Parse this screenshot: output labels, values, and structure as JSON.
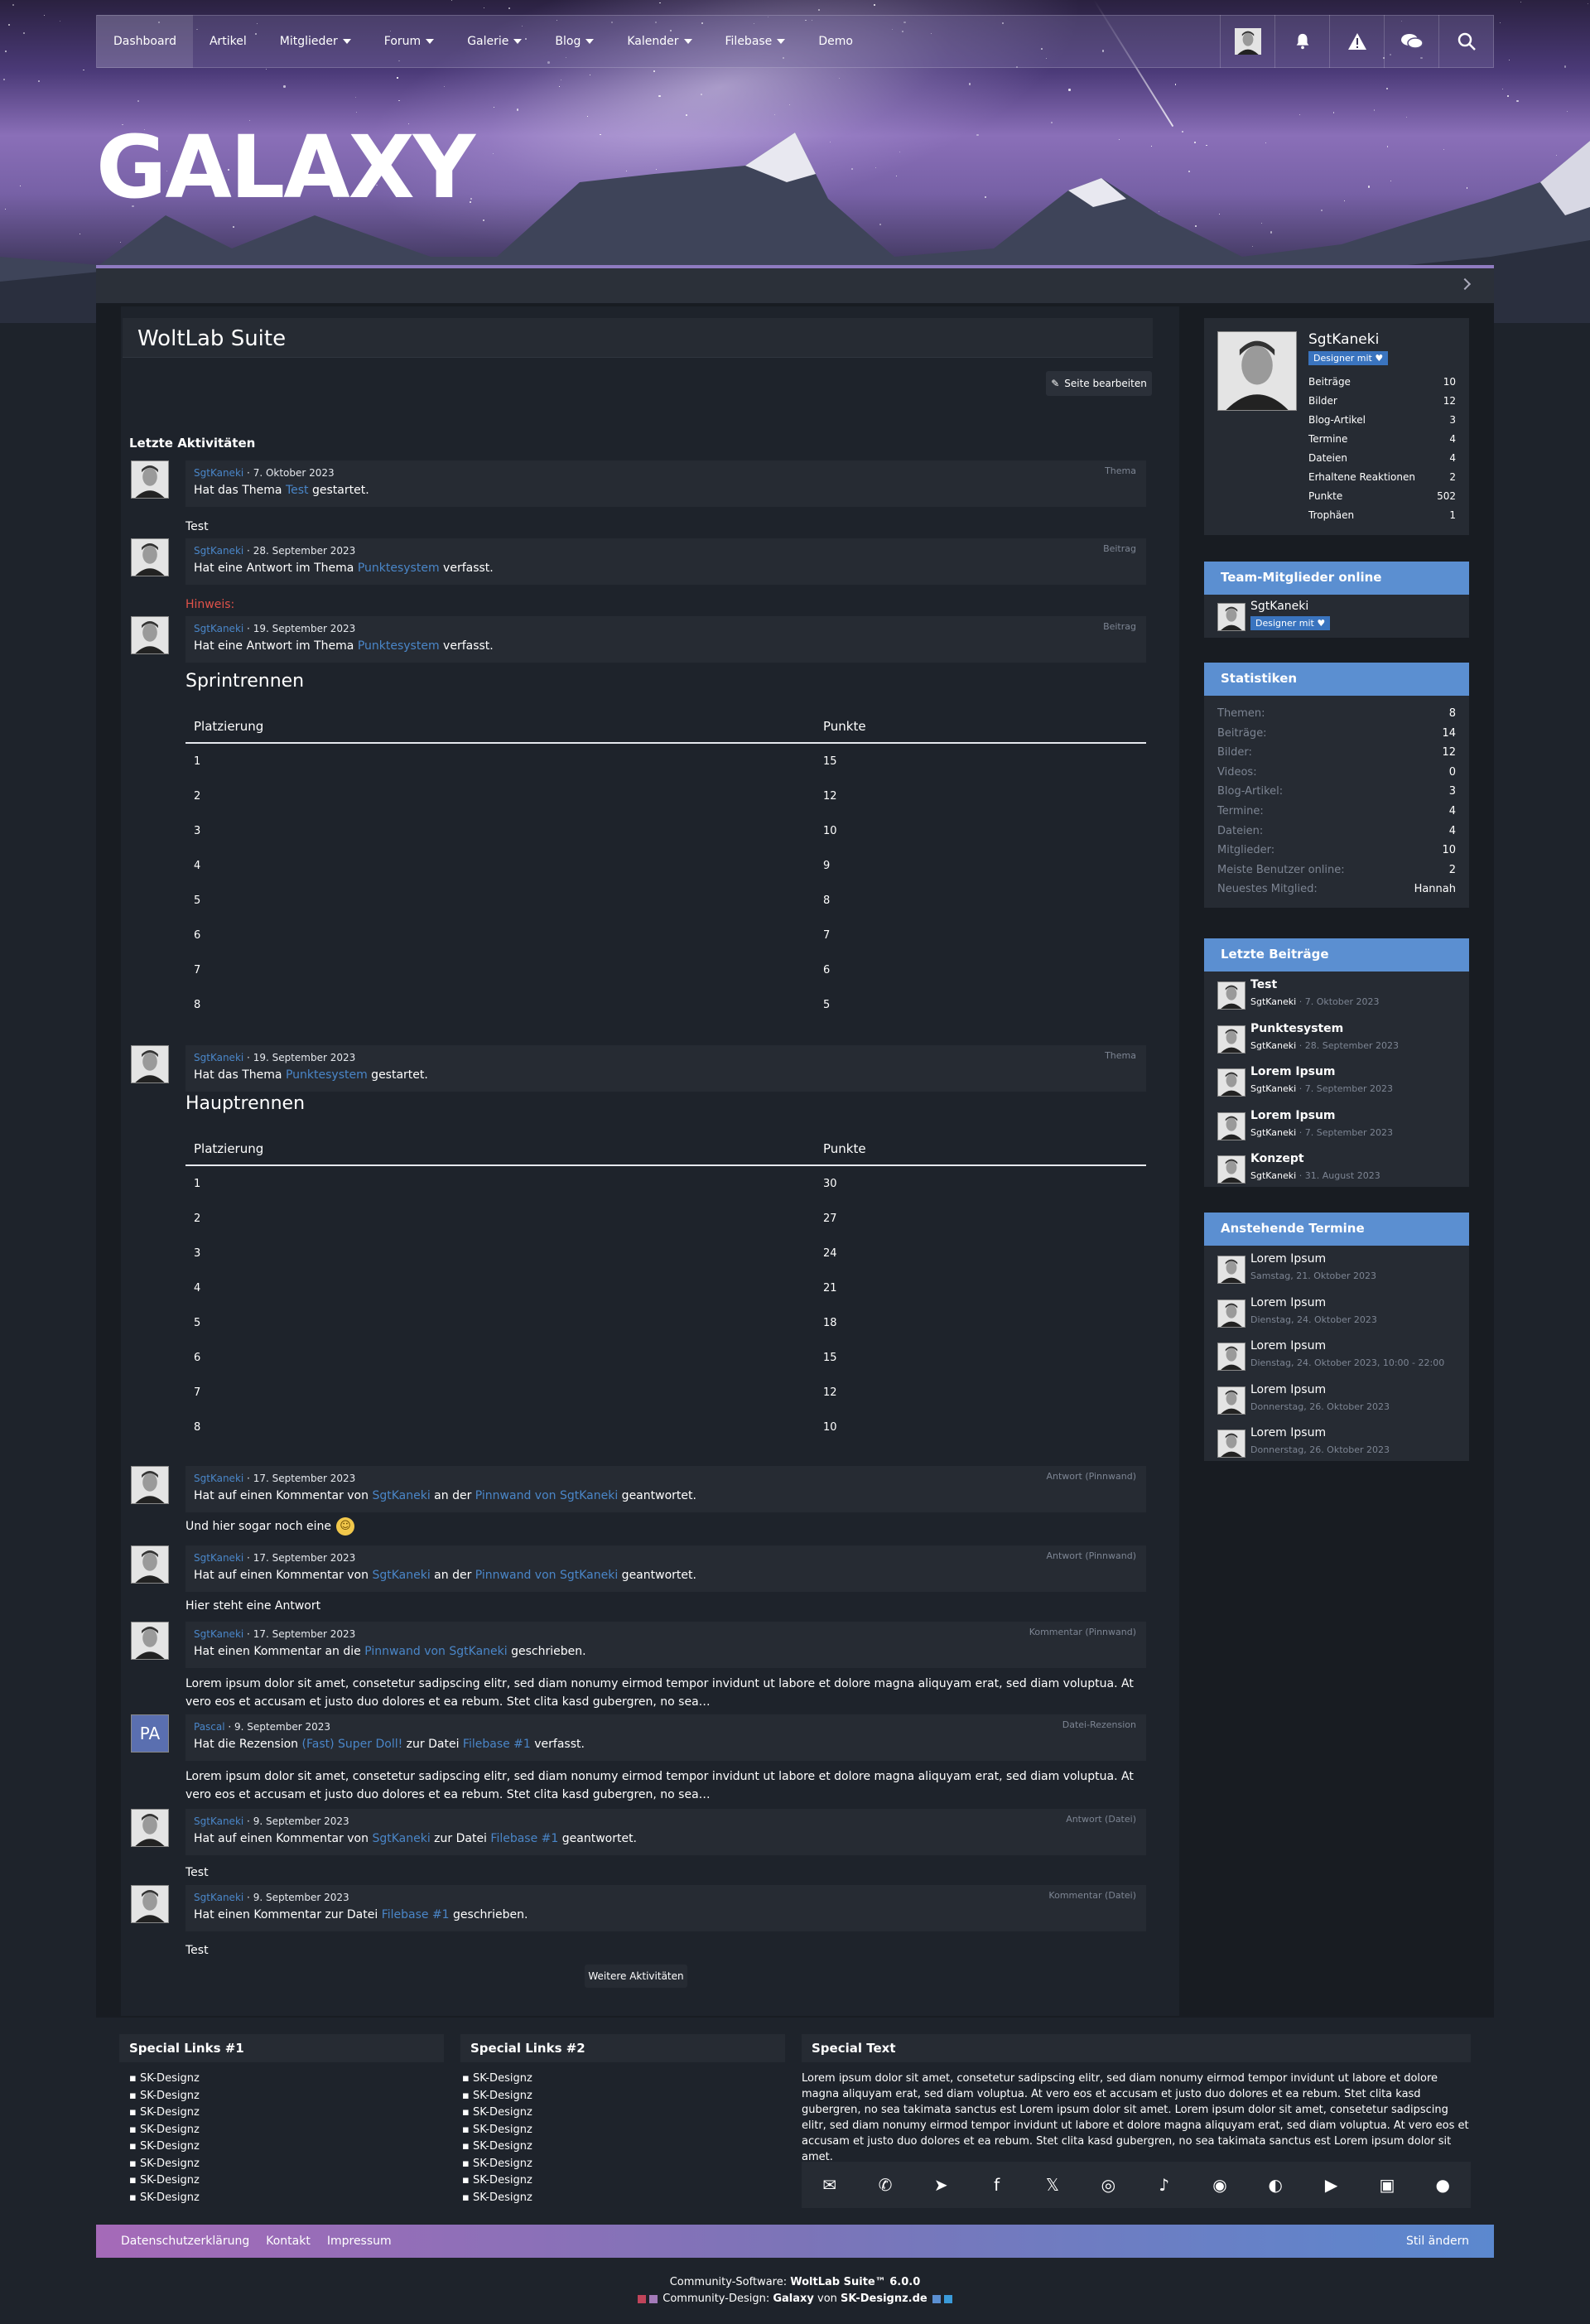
{
  "nav": {
    "items": [
      {
        "label": "Dashboard",
        "dropdown": false
      },
      {
        "label": "Artikel",
        "dropdown": false
      },
      {
        "label": "Mitglieder",
        "dropdown": true
      },
      {
        "label": "Forum",
        "dropdown": true
      },
      {
        "label": "Galerie",
        "dropdown": true
      },
      {
        "label": "Blog",
        "dropdown": true
      },
      {
        "label": "Kalender",
        "dropdown": true
      },
      {
        "label": "Filebase",
        "dropdown": true
      },
      {
        "label": "Demo",
        "dropdown": false
      }
    ],
    "icons": [
      "user-avatar",
      "bell-icon",
      "warning-icon",
      "chat-icon",
      "search-icon"
    ]
  },
  "logo": "GALAXY",
  "page_title": "WoltLab Suite",
  "edit_button": "Seite bearbeiten",
  "activity_title": "Letzte Aktivitäten",
  "activities": [
    {
      "user": "SgtKaneki",
      "date": "7. Oktober 2023",
      "type": "Thema",
      "pre": "Hat das Thema ",
      "link": "Test",
      "post": " gestartet.",
      "body": "Test"
    },
    {
      "user": "SgtKaneki",
      "date": "28. September 2023",
      "type": "Beitrag",
      "pre": "Hat eine Antwort im Thema ",
      "link": "Punktesystem",
      "post": " verfasst.",
      "body": "Hinweis:"
    },
    {
      "user": "SgtKaneki",
      "date": "19. September 2023",
      "type": "Beitrag",
      "pre": "Hat eine Antwort im Thema ",
      "link": "Punktesystem",
      "post": " verfasst."
    },
    {
      "user": "SgtKaneki",
      "date": "19. September 2023",
      "type": "Thema",
      "pre": "Hat das Thema ",
      "link": "Punktesystem",
      "post": " gestartet."
    },
    {
      "user": "SgtKaneki",
      "date": "17. September 2023",
      "type": "Antwort (Pinnwand)",
      "pre": "Hat auf einen Kommentar von ",
      "link": "SgtKaneki",
      "mid": " an der ",
      "link2": "Pinnwand von SgtKaneki",
      "post": " geantwortet.",
      "body": "Und hier sogar noch eine"
    },
    {
      "user": "SgtKaneki",
      "date": "17. September 2023",
      "type": "Antwort (Pinnwand)",
      "pre": "Hat auf einen Kommentar von ",
      "link": "SgtKaneki",
      "mid": " an der ",
      "link2": "Pinnwand von SgtKaneki",
      "post": " geantwortet.",
      "body": "Hier steht eine Antwort"
    },
    {
      "user": "SgtKaneki",
      "date": "17. September 2023",
      "type": "Kommentar (Pinnwand)",
      "pre": "Hat einen Kommentar an die ",
      "link": "Pinnwand von SgtKaneki",
      "post": " geschrieben.",
      "body": "Lorem ipsum dolor sit amet, consetetur sadipscing elitr, sed diam nonumy eirmod tempor invidunt ut labore et dolore magna aliquyam erat, sed diam voluptua. At vero eos et accusam et justo duo dolores et ea rebum. Stet clita kasd gubergren, no sea…"
    },
    {
      "user": "Pascal",
      "initials": "PA",
      "date": "9. September 2023",
      "type": "Datei-Rezension",
      "pre": "Hat die Rezension ",
      "link": "(Fast) Super Doll!",
      "mid": " zur Datei ",
      "link2": "Filebase #1",
      "post": " verfasst.",
      "body": "Lorem ipsum dolor sit amet, consetetur sadipscing elitr, sed diam nonumy eirmod tempor invidunt ut labore et dolore magna aliquyam erat, sed diam voluptua. At vero eos et accusam et justo duo dolores et ea rebum. Stet clita kasd gubergren, no sea…"
    },
    {
      "user": "SgtKaneki",
      "date": "9. September 2023",
      "type": "Antwort (Datei)",
      "pre": "Hat auf einen Kommentar von ",
      "link": "SgtKaneki",
      "mid": " zur Datei ",
      "link2": "Filebase #1",
      "post": " geantwortet.",
      "body": "Test"
    },
    {
      "user": "SgtKaneki",
      "date": "9. September 2023",
      "type": "Kommentar (Datei)",
      "pre": "Hat einen Kommentar zur Datei ",
      "link": "Filebase #1",
      "post": " geschrieben.",
      "body": "Test"
    }
  ],
  "tables": [
    {
      "title": "Sprintrennen",
      "headers": [
        "Platzierung",
        "Punkte"
      ],
      "rows": [
        [
          "1",
          "15"
        ],
        [
          "2",
          "12"
        ],
        [
          "3",
          "10"
        ],
        [
          "4",
          "9"
        ],
        [
          "5",
          "8"
        ],
        [
          "6",
          "7"
        ],
        [
          "7",
          "6"
        ],
        [
          "8",
          "5"
        ]
      ]
    },
    {
      "title": "Hauptrennen",
      "headers": [
        "Platzierung",
        "Punkte"
      ],
      "rows": [
        [
          "1",
          "30"
        ],
        [
          "2",
          "27"
        ],
        [
          "3",
          "24"
        ],
        [
          "4",
          "21"
        ],
        [
          "5",
          "18"
        ],
        [
          "6",
          "15"
        ],
        [
          "7",
          "12"
        ],
        [
          "8",
          "10"
        ]
      ]
    }
  ],
  "more_button": "Weitere Aktivitäten",
  "profile": {
    "name": "SgtKaneki",
    "badge": "Designer mit",
    "stats": [
      [
        "Beiträge",
        "10"
      ],
      [
        "Bilder",
        "12"
      ],
      [
        "Blog-Artikel",
        "3"
      ],
      [
        "Termine",
        "4"
      ],
      [
        "Dateien",
        "4"
      ],
      [
        "Erhaltene Reaktionen",
        "2"
      ],
      [
        "Punkte",
        "502"
      ],
      [
        "Trophäen",
        "1"
      ]
    ]
  },
  "team_online": {
    "title": "Team-Mitglieder online",
    "name": "SgtKaneki",
    "badge": "Designer mit"
  },
  "statistics": {
    "title": "Statistiken",
    "rows": [
      [
        "Themen:",
        "8"
      ],
      [
        "Beiträge:",
        "14"
      ],
      [
        "Bilder:",
        "12"
      ],
      [
        "Videos:",
        "0"
      ],
      [
        "Blog-Artikel:",
        "3"
      ],
      [
        "Termine:",
        "4"
      ],
      [
        "Dateien:",
        "4"
      ],
      [
        "Mitglieder:",
        "10"
      ],
      [
        "Meiste Benutzer online:",
        "2"
      ],
      [
        "Neuestes Mitglied:",
        "Hannah"
      ]
    ]
  },
  "latest_posts": {
    "title": "Letzte Beiträge",
    "items": [
      {
        "title": "Test",
        "user": "SgtKaneki",
        "date": "7. Oktober 2023"
      },
      {
        "title": "Punktesystem",
        "user": "SgtKaneki",
        "date": "28. September 2023"
      },
      {
        "title": "Lorem Ipsum",
        "user": "SgtKaneki",
        "date": "7. September 2023"
      },
      {
        "title": "Lorem Ipsum",
        "user": "SgtKaneki",
        "date": "7. September 2023"
      },
      {
        "title": "Konzept",
        "user": "SgtKaneki",
        "date": "31. August 2023"
      }
    ]
  },
  "upcoming_events": {
    "title": "Anstehende Termine",
    "items": [
      {
        "title": "Lorem Ipsum",
        "date": "Samstag, 21. Oktober 2023"
      },
      {
        "title": "Lorem Ipsum",
        "date": "Dienstag, 24. Oktober 2023"
      },
      {
        "title": "Lorem Ipsum",
        "date": "Dienstag, 24. Oktober 2023, 10:00 - 22:00"
      },
      {
        "title": "Lorem Ipsum",
        "date": "Donnerstag, 26. Oktober 2023"
      },
      {
        "title": "Lorem Ipsum",
        "date": "Donnerstag, 26. Oktober 2023"
      }
    ]
  },
  "footer": {
    "col1_title": "Special Links #1",
    "col2_title": "Special Links #2",
    "col3_title": "Special Text",
    "links": [
      "SK-Designz",
      "SK-Designz",
      "SK-Designz",
      "SK-Designz",
      "SK-Designz",
      "SK-Designz",
      "SK-Designz",
      "SK-Designz"
    ],
    "special_text": "Lorem ipsum dolor sit amet, consetetur sadipscing elitr, sed diam nonumy eirmod tempor invidunt ut labore et dolore magna aliquyam erat, sed diam voluptua. At vero eos et accusam et justo duo dolores et ea rebum. Stet clita kasd gubergren, no sea takimata sanctus est Lorem ipsum dolor sit amet. Lorem ipsum dolor sit amet, consetetur sadipscing elitr, sed diam nonumy eirmod tempor invidunt ut labore et dolore magna aliquyam erat, sed diam voluptua. At vero eos et accusam et justo duo dolores et ea rebum. Stet clita kasd gubergren, no sea takimata sanctus est Lorem ipsum dolor sit amet.",
    "social_icons": [
      "mail-icon",
      "whatsapp-icon",
      "telegram-icon",
      "facebook-icon",
      "x-icon",
      "instagram-icon",
      "tiktok-icon",
      "discord-icon",
      "teamspeak-icon",
      "youtube-icon",
      "twitch-icon",
      "reddit-icon"
    ],
    "bar_links": [
      "Datenschutzerklärung",
      "Kontakt",
      "Impressum"
    ],
    "style_change": "Stil ändern",
    "copyright1_pre": "Community-Software: ",
    "copyright1_brand": "WoltLab Suite™ 6.0.0",
    "copyright2_pre": "Community-Design: ",
    "copyright2_brand": "Galaxy",
    "copyright2_mid": " von ",
    "copyright2_author": "SK-Designz.de"
  },
  "colors": {
    "accent": "#5b8fd1",
    "link": "#4a86c8",
    "background": "#1e232b",
    "warning": "#e0524a"
  }
}
